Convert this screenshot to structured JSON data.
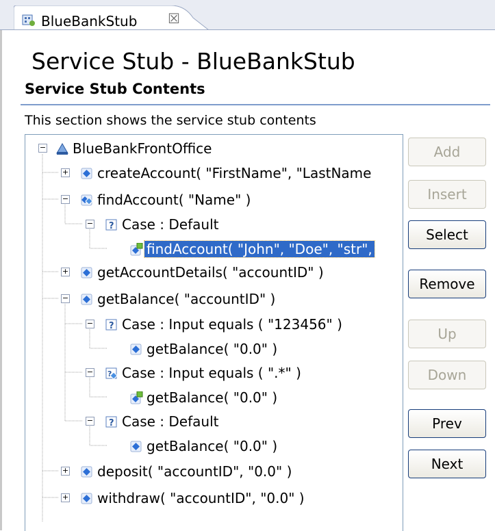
{
  "tab": {
    "label": "BlueBankStub",
    "close": "☒"
  },
  "page": {
    "title": "Service Stub - BlueBankStub",
    "section_title": "Service Stub Contents",
    "description": "This section shows the service stub contents"
  },
  "tree": {
    "root": "BlueBankFrontOffice",
    "n1": "createAccount( \"FirstName\", \"LastName",
    "n2": "findAccount( \"Name\" )",
    "n2a": "Case : Default",
    "n2a1": "findAccount( \"John\", \"Doe\", \"str\",",
    "n3": "getAccountDetails( \"accountID\" )",
    "n4": "getBalance( \"accountID\" )",
    "n4a": "Case : Input equals ( \"123456\" )",
    "n4a1": "getBalance( \"0.0\" )",
    "n4b": "Case : Input equals ( \".*\" )",
    "n4b1": "getBalance( \"0.0\" )",
    "n4c": "Case : Default",
    "n4c1": "getBalance( \"0.0\" )",
    "n5": "deposit( \"accountID\", \"0.0\" )",
    "n6": "withdraw( \"accountID\", \"0.0\" )"
  },
  "buttons": {
    "add": "Add",
    "insert": "Insert",
    "select": "Select",
    "remove": "Remove",
    "up": "Up",
    "down": "Down",
    "prev": "Prev",
    "next": "Next"
  },
  "colors": {
    "selection": "#2f6ac8",
    "operation_icon": "#2c6fd6",
    "accent_line": "#7e9ccc"
  }
}
